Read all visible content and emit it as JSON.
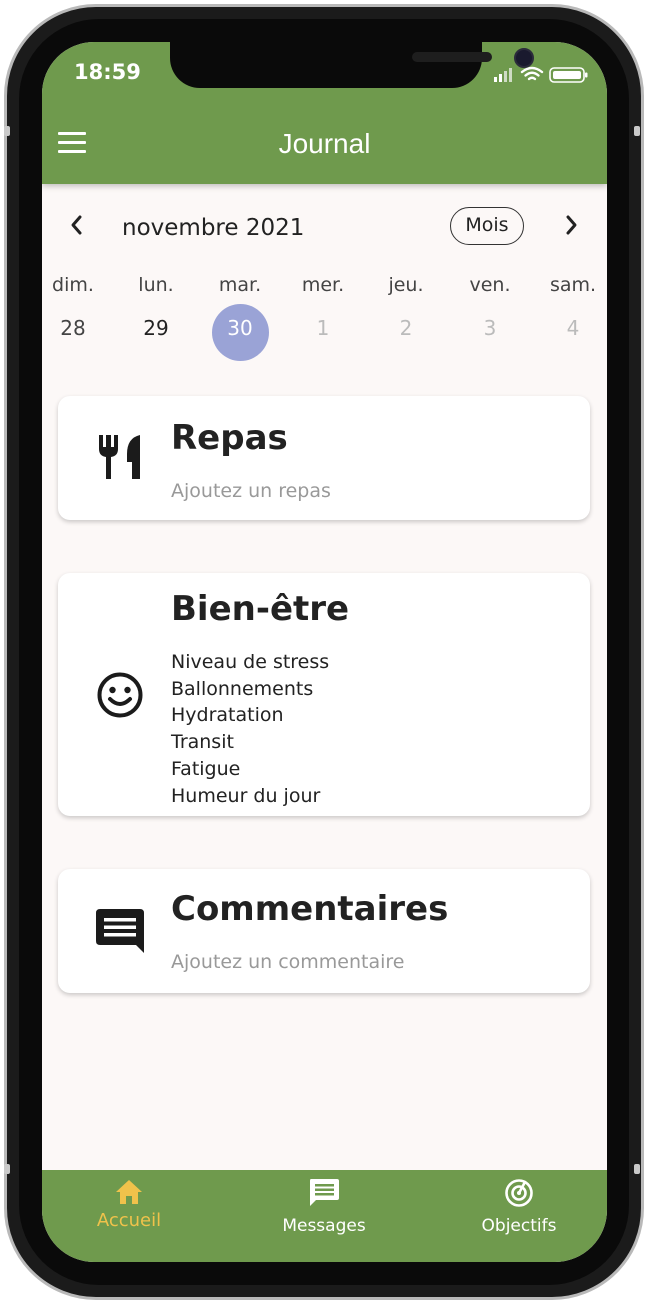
{
  "status_bar": {
    "time": "18:59"
  },
  "header": {
    "title": "Journal"
  },
  "calendar": {
    "month_label": "novembre 2021",
    "mode_label": "Mois",
    "weekdays": [
      "dim.",
      "lun.",
      "mar.",
      "mer.",
      "jeu.",
      "ven.",
      "sam."
    ],
    "dates": [
      "28",
      "29",
      "30",
      "1",
      "2",
      "3",
      "4"
    ],
    "selected_date": "30"
  },
  "cards": {
    "repas": {
      "title": "Repas",
      "subtitle": "Ajoutez un repas",
      "icon": "utensils-icon"
    },
    "bien_etre": {
      "title": "Bien-être",
      "icon": "smiley-icon",
      "items": [
        "Niveau de stress",
        "Ballonnements",
        "Hydratation",
        "Transit",
        "Fatigue",
        "Humeur du jour"
      ]
    },
    "commentaires": {
      "title": "Commentaires",
      "subtitle": "Ajoutez un commentaire",
      "icon": "comment-icon"
    }
  },
  "bottom_nav": {
    "items": [
      {
        "label": "Accueil",
        "icon": "home-icon",
        "active": true
      },
      {
        "label": "Messages",
        "icon": "message-icon",
        "active": false
      },
      {
        "label": "Objectifs",
        "icon": "target-icon",
        "active": false
      }
    ]
  },
  "colors": {
    "brand_green": "#6f9a4d",
    "active_yellow": "#f0c24b",
    "selected_date": "#9aa3d6",
    "background": "#fcf8f7"
  }
}
